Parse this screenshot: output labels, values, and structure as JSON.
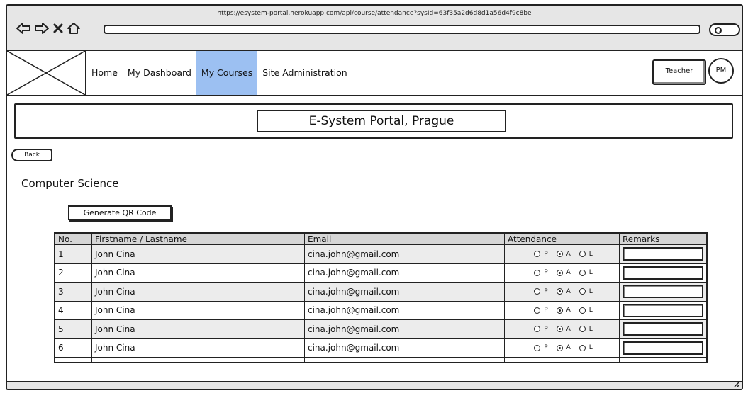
{
  "browser": {
    "url": "https://esystem-portal.herokuapp.com/api/course/attendance?sysId=63f35a2d6d8d1a56d4f9c8be",
    "icons": [
      "back-arrow-icon",
      "forward-arrow-icon",
      "close-icon",
      "home-icon",
      "search-icon"
    ]
  },
  "header": {
    "nav": [
      {
        "label": "Home"
      },
      {
        "label": "My Dashboard"
      },
      {
        "label": "My Courses"
      },
      {
        "label": "Site Administration"
      }
    ],
    "active_nav": "My Courses",
    "role_label": "Teacher",
    "avatar_initials": "PM"
  },
  "banner": {
    "title": "E-System Portal, Prague"
  },
  "back_label": "Back",
  "course_name": "Computer Science",
  "qr_button_label": "Generate QR Code",
  "table": {
    "columns": [
      "No.",
      "Firstname / Lastname",
      "Email",
      "Attendance",
      "Remarks"
    ],
    "attendance_options": [
      "P",
      "A",
      "L"
    ],
    "rows": [
      {
        "no": "1",
        "name": "John Cina",
        "email": "cina.john@gmail.com",
        "attendance": "A",
        "remarks": ""
      },
      {
        "no": "2",
        "name": "John Cina",
        "email": "cina.john@gmail.com",
        "attendance": "A",
        "remarks": ""
      },
      {
        "no": "3",
        "name": "John Cina",
        "email": "cina.john@gmail.com",
        "attendance": "A",
        "remarks": ""
      },
      {
        "no": "4",
        "name": "John Cina",
        "email": "cina.john@gmail.com",
        "attendance": "A",
        "remarks": ""
      },
      {
        "no": "5",
        "name": "John Cina",
        "email": "cina.john@gmail.com",
        "attendance": "A",
        "remarks": ""
      },
      {
        "no": "6",
        "name": "John Cina",
        "email": "cina.john@gmail.com",
        "attendance": "A",
        "remarks": ""
      }
    ]
  },
  "colors": {
    "active_nav_bg": "#9cc0f2",
    "header_row_bg": "#d6d6d6",
    "alt_row_bg": "#ececec",
    "chrome_bg": "#e6e6e6"
  }
}
